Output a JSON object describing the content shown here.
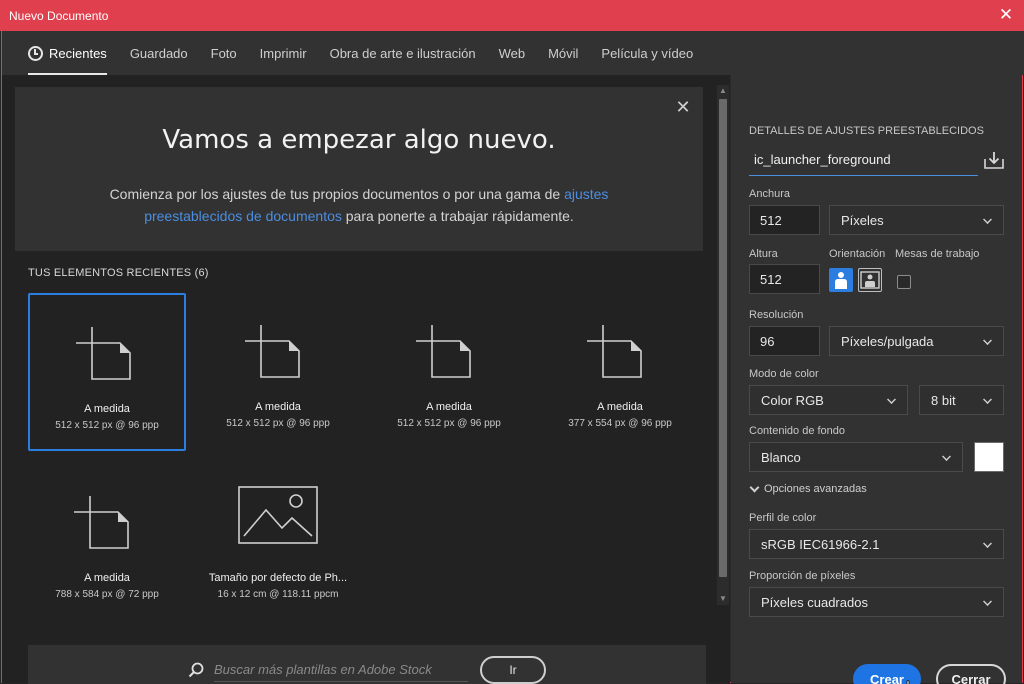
{
  "window": {
    "title": "Nuevo Documento",
    "close_glyph": "✕"
  },
  "tabs": [
    {
      "label": "Recientes",
      "active": true
    },
    {
      "label": "Guardado"
    },
    {
      "label": "Foto"
    },
    {
      "label": "Imprimir"
    },
    {
      "label": "Obra de arte e ilustración"
    },
    {
      "label": "Web"
    },
    {
      "label": "Móvil"
    },
    {
      "label": "Película y vídeo"
    }
  ],
  "welcome": {
    "close_glyph": "✕",
    "heading": "Vamos a empezar algo nuevo.",
    "text_before": "Comienza por los ajustes de tus propios documentos o por una gama de ",
    "link": "ajustes preestablecidos de documentos",
    "text_after": " para ponerte a trabajar rápidamente."
  },
  "recent": {
    "title": "TUS ELEMENTOS RECIENTES",
    "count": "(6)",
    "items": [
      {
        "name": "A medida",
        "size": "512 x 512 px @ 96 ppp",
        "icon": "new-document-icon",
        "selected": true
      },
      {
        "name": "A medida",
        "size": "512 x 512 px @ 96 ppp",
        "icon": "new-document-icon"
      },
      {
        "name": "A medida",
        "size": "512 x 512 px @ 96 ppp",
        "icon": "new-document-icon"
      },
      {
        "name": "A medida",
        "size": "377 x 554 px @ 96 ppp",
        "icon": "new-document-icon"
      },
      {
        "name": "A medida",
        "size": "788 x 584 px @ 72 ppp",
        "icon": "new-document-icon"
      },
      {
        "name": "Tamaño por defecto de Ph...",
        "size": "16 x 12 cm @ 118.11 ppcm",
        "icon": "image-placeholder-icon"
      }
    ]
  },
  "stock": {
    "placeholder": "Buscar más plantillas en Adobe Stock",
    "go_label": "Ir"
  },
  "details": {
    "title": "DETALLES DE AJUSTES PREESTABLECIDOS",
    "preset_name": "ic_launcher_foreground",
    "width_label": "Anchura",
    "width_value": "512",
    "width_unit": "Píxeles",
    "height_label": "Altura",
    "height_value": "512",
    "orientation_label": "Orientación",
    "artboards_label": "Mesas de trabajo",
    "resolution_label": "Resolución",
    "resolution_value": "96",
    "resolution_unit": "Píxeles/pulgada",
    "color_mode_label": "Modo de color",
    "color_mode": "Color RGB",
    "bit_depth": "8 bit",
    "background_label": "Contenido de fondo",
    "background": "Blanco",
    "background_color": "#ffffff",
    "advanced_label": "Opciones avanzadas",
    "profile_label": "Perfil de color",
    "profile": "sRGB IEC61966-2.1",
    "pixel_ratio_label": "Proporción de píxeles",
    "pixel_ratio": "Píxeles cuadrados"
  },
  "actions": {
    "create_label": "Crear",
    "close_label": "Cerrar"
  },
  "colors": {
    "titlebar": "#e0404e",
    "accent": "#1f74e3",
    "link": "#4c8ee0"
  }
}
